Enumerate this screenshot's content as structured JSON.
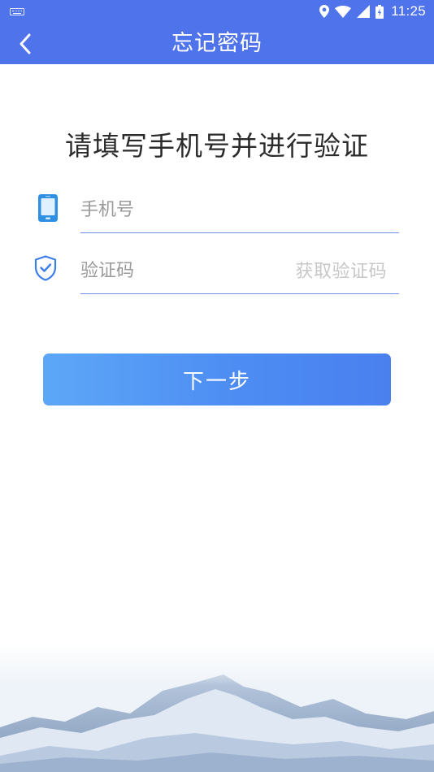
{
  "status_bar": {
    "time": "11:25",
    "icons": [
      "keyboard-icon",
      "location-icon",
      "wifi-icon",
      "signal-icon",
      "battery-icon"
    ]
  },
  "nav": {
    "title": "忘记密码",
    "back_icon": "chevron-left-icon"
  },
  "main": {
    "heading": "请填写手机号并进行验证",
    "phone": {
      "icon": "phone-icon",
      "placeholder": "手机号",
      "value": ""
    },
    "code": {
      "icon": "shield-check-icon",
      "placeholder": "验证码",
      "value": "",
      "get_code_label": "获取验证码"
    },
    "next_button": "下一步"
  },
  "colors": {
    "brand": "#4f73ea",
    "button_start": "#5da7f7",
    "button_end": "#4a80ee",
    "underline": "#6f8fe8",
    "placeholder": "#9a9a9a",
    "get_code": "#c7c7c7"
  }
}
